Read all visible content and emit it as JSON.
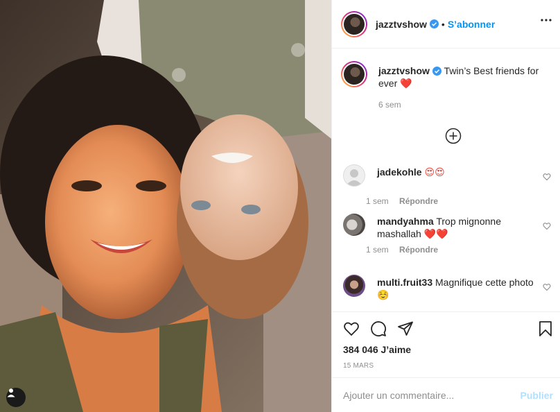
{
  "post": {
    "username": "jazztvshow",
    "follow_label": "S’abonner",
    "separator": "•",
    "caption": {
      "username": "jazztvshow",
      "text": "Twin’s Best friends for ever",
      "emoji": "❤️",
      "time": "6 sem"
    },
    "comments": [
      {
        "username": "jadekohle",
        "text": "",
        "emoji": "😍😍",
        "time": "1 sem",
        "reply_label": "Répondre"
      },
      {
        "username": "mandyahma",
        "text": "Trop mignonne mashallah",
        "emoji": "❤️❤️",
        "time": "1 sem",
        "reply_label": "Répondre"
      },
      {
        "username": "multi.fruit33",
        "text": "Magnifique cette photo",
        "emoji": "☺️"
      }
    ],
    "likes": "384 046 J’aime",
    "date": "15 MARS",
    "add_comment_placeholder": "Ajouter un commentaire...",
    "publish_label": "Publier"
  },
  "icons": {
    "verified": "verified-badge-icon",
    "more": "more-options-icon",
    "load_more": "load-more-comments-icon",
    "like": "heart-icon",
    "comment": "comment-icon",
    "share": "share-icon",
    "save": "bookmark-icon",
    "tagged": "user-tag-icon"
  },
  "colors": {
    "accent": "#0095f6",
    "publish_disabled": "#b2dffc",
    "muted": "#8e8e8e"
  }
}
